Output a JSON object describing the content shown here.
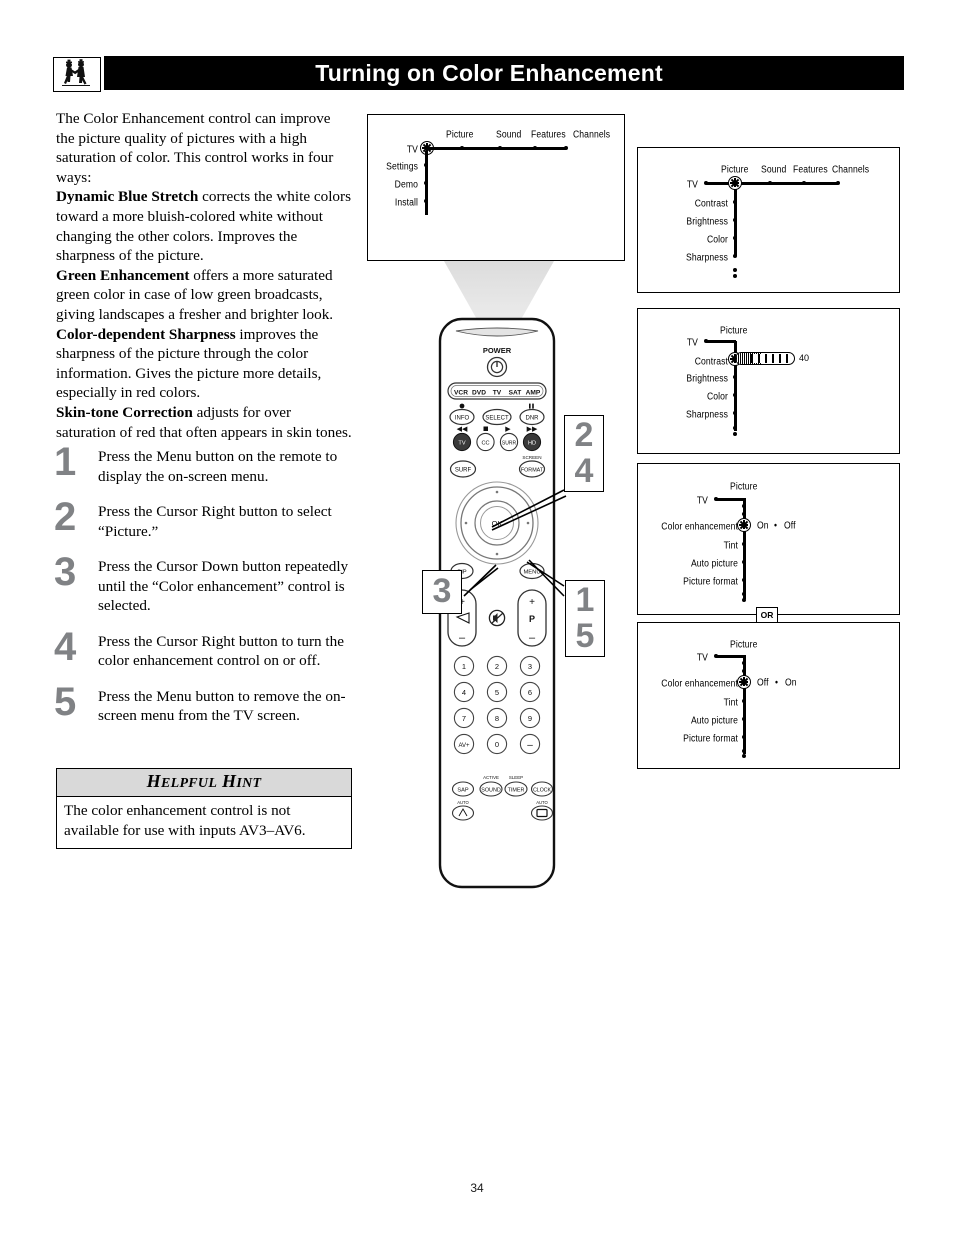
{
  "page": {
    "title": "Turning on Color Enhancement",
    "page_number": "34",
    "header_icon": "people-illustration-icon"
  },
  "intro": {
    "p1_plain": "The Color Enhancement control can improve the picture quality of pictures with a high saturation of color. This control works in four ways:",
    "terms": [
      {
        "name": "Dynamic Blue Stretch",
        "desc": " corrects the white colors toward a more bluish-colored white without changing the other colors. Improves the sharpness of the picture."
      },
      {
        "name": "Green Enhancement",
        "desc": " offers a more saturated green color in case of low green broadcasts, giving landscapes a fresher and brighter look."
      },
      {
        "name": "Color-dependent Sharpness",
        "desc": " improves the sharpness of the picture through the color information. Gives the picture more details, especially in red colors."
      },
      {
        "name": "Skin-tone Correction",
        "desc": " adjusts for over saturation of red that often appears in skin tones."
      }
    ]
  },
  "steps": [
    {
      "num": "1",
      "text": "Press the Menu button on the remote to display the on-screen menu."
    },
    {
      "num": "2",
      "text": "Press the Cursor Right button to select “Picture.”"
    },
    {
      "num": "3",
      "text": "Press the Cursor Down button repeatedly until the “Color enhancement” control is selected."
    },
    {
      "num": "4",
      "text": "Press the Cursor Right button to turn the color enhancement control on or off."
    },
    {
      "num": "5",
      "text": "Press the Menu button to remove the on-screen menu from the TV screen."
    }
  ],
  "hint": {
    "title_h": "H",
    "title_elpful": "ELPFUL",
    "title_h2": "H",
    "title_int": "INT",
    "body": "The color enhancement control is not available for use with inputs AV3–AV6."
  },
  "menus": {
    "main": {
      "root_label": "TV",
      "top_items": [
        "Picture",
        "Sound",
        "Features",
        "Channels"
      ],
      "side_items": [
        "Settings",
        "Demo",
        "Install"
      ],
      "cursor_on": "TV"
    },
    "picture_top": {
      "root_label": "TV",
      "top_items": [
        "Picture",
        "Sound",
        "Features",
        "Channels"
      ],
      "side_items": [
        "Contrast",
        "Brightness",
        "Color",
        "Sharpness"
      ],
      "cursor_on": "Picture"
    },
    "contrast": {
      "root_label": "TV",
      "column_title": "Picture",
      "side_items": [
        "Contrast",
        "Brightness",
        "Color",
        "Sharpness"
      ],
      "cursor_on": "Contrast",
      "slider_value": "40"
    },
    "color_enh_on": {
      "root_label": "TV",
      "column_title": "Picture",
      "side_items": [
        "Color enhancement",
        "Tint",
        "Auto picture",
        "Picture format"
      ],
      "cursor_on": "Color enhancement",
      "option_first": "On",
      "option_sep": "•",
      "option_second": "Off"
    },
    "or_divider": "OR",
    "color_enh_off": {
      "root_label": "TV",
      "column_title": "Picture",
      "side_items": [
        "Color enhancement",
        "Tint",
        "Auto picture",
        "Picture format"
      ],
      "cursor_on": "Color enhancement",
      "option_first": "Off",
      "option_sep": "•",
      "option_second": "On"
    }
  },
  "remote": {
    "power_label": "POWER",
    "mode_buttons": [
      "VCR",
      "DVD",
      "TV",
      "SAT",
      "AMP"
    ],
    "row_info": [
      "INFO",
      "SELECT",
      "DNR"
    ],
    "row_media": [
      "TV",
      "CC",
      "SURR",
      "HD"
    ],
    "surf_button": "SURF",
    "screen_label": "SCREEN",
    "format_button": "FORMAT",
    "ok_button": "OK",
    "pip_button": "PIP",
    "menu_button": "MENU",
    "volume_plus": "+",
    "volume_minus": "–",
    "program_plus": "+",
    "program_minus": "–",
    "program_label": "P",
    "mute_icon": "mute-icon",
    "numbers": [
      "1",
      "2",
      "3",
      "4",
      "5",
      "6",
      "7",
      "8",
      "9",
      "AV+",
      "0",
      "–"
    ],
    "bottom_row1": [
      "SAP",
      "SOUND",
      "TIMER",
      "CLOCK"
    ],
    "bottom_labels": [
      "ACTIVE",
      "SLEEP"
    ],
    "bottom_row2_labels": [
      "AUTO",
      "AUTO"
    ]
  },
  "callouts": {
    "c24_top": "2",
    "c24_bottom": "4",
    "c3": "3",
    "c15_top": "1",
    "c15_bottom": "5"
  },
  "colors": {
    "header_bg": "#000000",
    "header_text": "#ffffff",
    "step_number": "#808285",
    "hint_header_bg": "#d9d9d9",
    "beam": "#e3e3e3"
  }
}
